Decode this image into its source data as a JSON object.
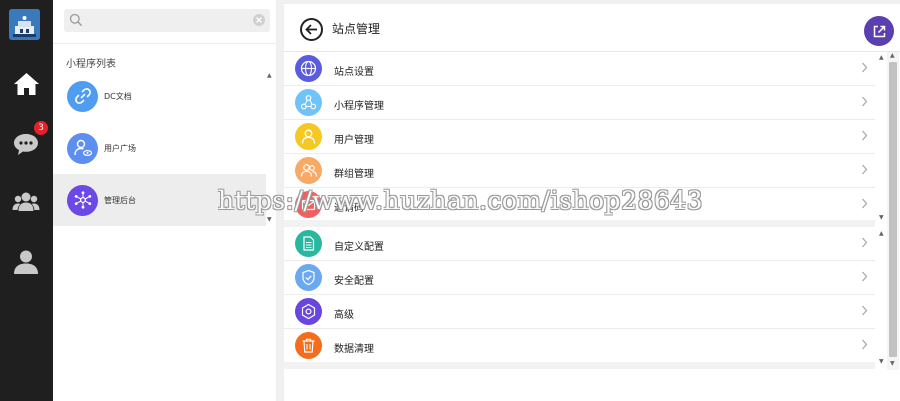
{
  "rail": {
    "badge": "3"
  },
  "search": {
    "value": "",
    "placeholder": ""
  },
  "mini_programs": {
    "heading": "小程序列表",
    "items": [
      {
        "label": "DC文档",
        "icon": "link-icon",
        "color": "#4f9df2"
      },
      {
        "label": "用户广场",
        "icon": "user-eye-icon",
        "color": "#5d8ff0"
      },
      {
        "label": "管理后台",
        "icon": "network-icon",
        "color": "#6a49e6"
      }
    ]
  },
  "header": {
    "title": "站点管理"
  },
  "menu_group_1": [
    {
      "label": "站点设置",
      "icon": "globe-icon",
      "color": "#5b5bdf"
    },
    {
      "label": "小程序管理",
      "icon": "cluster-icon",
      "color": "#6fc3f7"
    },
    {
      "label": "用户管理",
      "icon": "user-icon",
      "color": "#f6c824"
    },
    {
      "label": "群组管理",
      "icon": "group-icon",
      "color": "#f8a966"
    },
    {
      "label": "邀请码",
      "icon": "invite-icon",
      "color": "#f06060"
    }
  ],
  "menu_group_2": [
    {
      "label": "自定义配置",
      "icon": "document-icon",
      "color": "#2ab7a0"
    },
    {
      "label": "安全配置",
      "icon": "shield-icon",
      "color": "#6aa8f0"
    },
    {
      "label": "高级",
      "icon": "hexagon-gear-icon",
      "color": "#6a45e0"
    },
    {
      "label": "数据清理",
      "icon": "trash-icon",
      "color": "#f56d1c"
    }
  ],
  "watermark": "https://www.huzhan.com/ishop28643"
}
